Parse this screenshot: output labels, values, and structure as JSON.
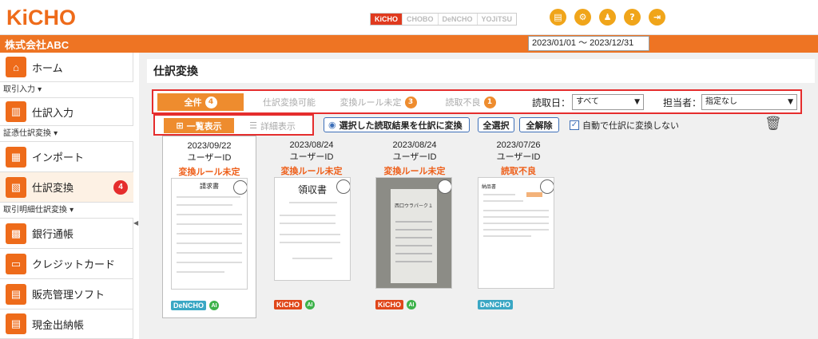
{
  "app": {
    "logo": "KiCHO",
    "products": [
      "KiCHO",
      "CHOBO",
      "DeNCHO",
      "YOJiTSU"
    ],
    "active_product": "KiCHO",
    "company": "株式会社ABC",
    "date_range": "2023/01/01 〜 2023/12/31",
    "header_icons": [
      "document-icon",
      "settings-icon",
      "user-icon",
      "help-icon",
      "logout-icon"
    ]
  },
  "sidebar": {
    "home": "ホーム",
    "section1": "取引入力",
    "journal_input": "仕訳入力",
    "section2": "証憑仕訳変換",
    "import": "インポート",
    "convert": "仕訳変換",
    "convert_badge": "4",
    "section3": "取引明細仕訳変換",
    "bank": "銀行通帳",
    "credit": "クレジットカード",
    "sales": "販売管理ソフト",
    "cash": "現金出納帳"
  },
  "page": {
    "title": "仕訳変換",
    "tabs": [
      {
        "label": "全件",
        "count": "4"
      },
      {
        "label": "仕訳変換可能",
        "count": ""
      },
      {
        "label": "変換ルール未定",
        "count": "3"
      },
      {
        "label": "読取不良",
        "count": "1"
      }
    ],
    "read_date_label": "読取日：",
    "read_date_value": "すべて",
    "owner_label": "担当者：",
    "owner_value": "指定なし",
    "view_list": "一覧表示",
    "view_detail": "詳細表示",
    "convert_selected": "選択した読取結果を仕訳に変換",
    "select_all": "全選択",
    "deselect_all": "全解除",
    "auto_convert": "自動で仕訳に変換しない"
  },
  "cards": [
    {
      "date": "2023/09/22",
      "uid": "ユーザーID",
      "status": "変換ルール未定",
      "tags": [
        "DeNCHO",
        "AI"
      ],
      "doc_title": "請求書"
    },
    {
      "date": "2023/08/24",
      "uid": "ユーザーID",
      "status": "変換ルール未定",
      "tags": [
        "KiCHO",
        "AI"
      ],
      "doc_title": "領収書"
    },
    {
      "date": "2023/08/24",
      "uid": "ユーザーID",
      "status": "変換ルール未定",
      "tags": [
        "KiCHO",
        "AI"
      ],
      "doc_title": "西口ウラパーク１"
    },
    {
      "date": "2023/07/26",
      "uid": "ユーザーID",
      "status": "読取不良",
      "tags": [
        "DeNCHO"
      ],
      "doc_title": "納品書"
    }
  ]
}
